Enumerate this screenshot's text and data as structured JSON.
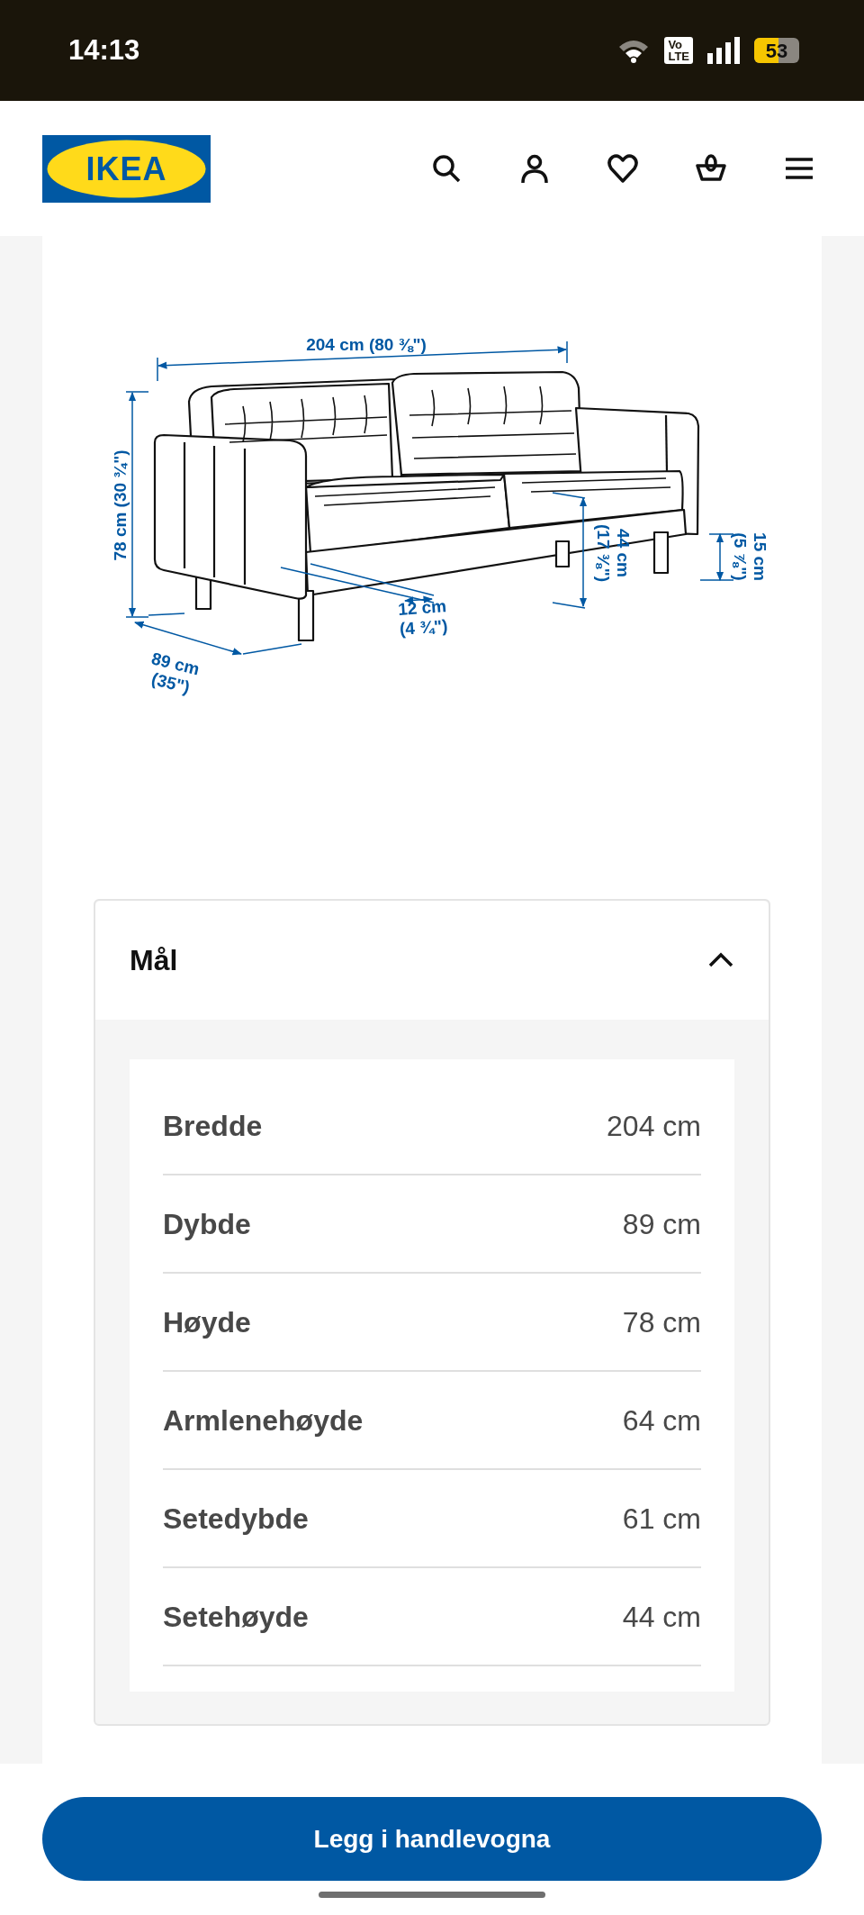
{
  "status_bar": {
    "time": "14:13",
    "network_badge": [
      "Vo",
      "LTE"
    ],
    "battery": "53"
  },
  "header": {
    "logo_text": "IKEA",
    "icons": [
      {
        "kind": "search"
      },
      {
        "kind": "account"
      },
      {
        "kind": "favourites"
      },
      {
        "kind": "basket"
      },
      {
        "kind": "menu"
      }
    ]
  },
  "dimension_drawing": {
    "labels": [
      {
        "kind": "top",
        "lines": [
          "204 cm (80 ⅜\")"
        ]
      },
      {
        "kind": "left",
        "lines": [
          "78 cm (30 ¾\")"
        ]
      },
      {
        "kind": "depth",
        "lines": [
          "89 cm",
          "(35\")"
        ]
      },
      {
        "kind": "arm",
        "lines": [
          "12 cm",
          "(4 ¾\")"
        ]
      },
      {
        "kind": "seat",
        "lines": [
          "44 cm",
          "(17 ⅜\")"
        ]
      },
      {
        "kind": "leg",
        "lines": [
          "15 cm",
          "(5 ⅞\")"
        ]
      }
    ]
  },
  "accordion": {
    "title": "Mål",
    "expanded": true,
    "rows": [
      {
        "label": "Bredde",
        "value": "204 cm"
      },
      {
        "label": "Dybde",
        "value": "89 cm"
      },
      {
        "label": "Høyde",
        "value": "78 cm"
      },
      {
        "label": "Armlenehøyde",
        "value": "64 cm"
      },
      {
        "label": "Setedybde",
        "value": "61 cm"
      },
      {
        "label": "Setehøyde",
        "value": "44 cm"
      }
    ]
  },
  "add_to_cart_button": "Legg i handlevogna"
}
